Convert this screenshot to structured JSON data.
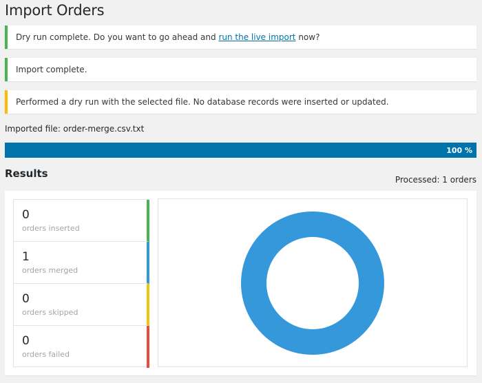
{
  "page": {
    "title": "Import Orders"
  },
  "notices": {
    "dry_run": {
      "text_before": "Dry run complete. Do you want to go ahead and ",
      "link_text": "run the live import",
      "text_after": " now?"
    },
    "import_complete": {
      "text": "Import complete."
    },
    "warning": {
      "text": "Performed a dry run with the selected file. No database records were inserted or updated."
    }
  },
  "import": {
    "file_label": "Imported file: order-merge.csv.txt",
    "progress_text": "100 %",
    "progress_fraction": 1.0
  },
  "results": {
    "title": "Results",
    "processed": "Processed: 1 orders",
    "stats": [
      {
        "value": "0",
        "label": "orders inserted"
      },
      {
        "value": "1",
        "label": "orders merged"
      },
      {
        "value": "0",
        "label": "orders skipped"
      },
      {
        "value": "0",
        "label": "orders failed"
      }
    ]
  },
  "colors": {
    "success": "#46b450",
    "warning": "#ffb900",
    "progress": "#0073aa",
    "inserted": "#46b450",
    "merged": "#3498db",
    "skipped": "#f1c40f",
    "failed": "#e74c3c"
  },
  "chart_data": {
    "type": "pie",
    "categories": [
      "orders inserted",
      "orders merged",
      "orders skipped",
      "orders failed"
    ],
    "values": [
      0,
      1,
      0,
      0
    ],
    "colors": [
      "#46b450",
      "#3498db",
      "#f1c40f",
      "#e74c3c"
    ],
    "donut": true
  }
}
